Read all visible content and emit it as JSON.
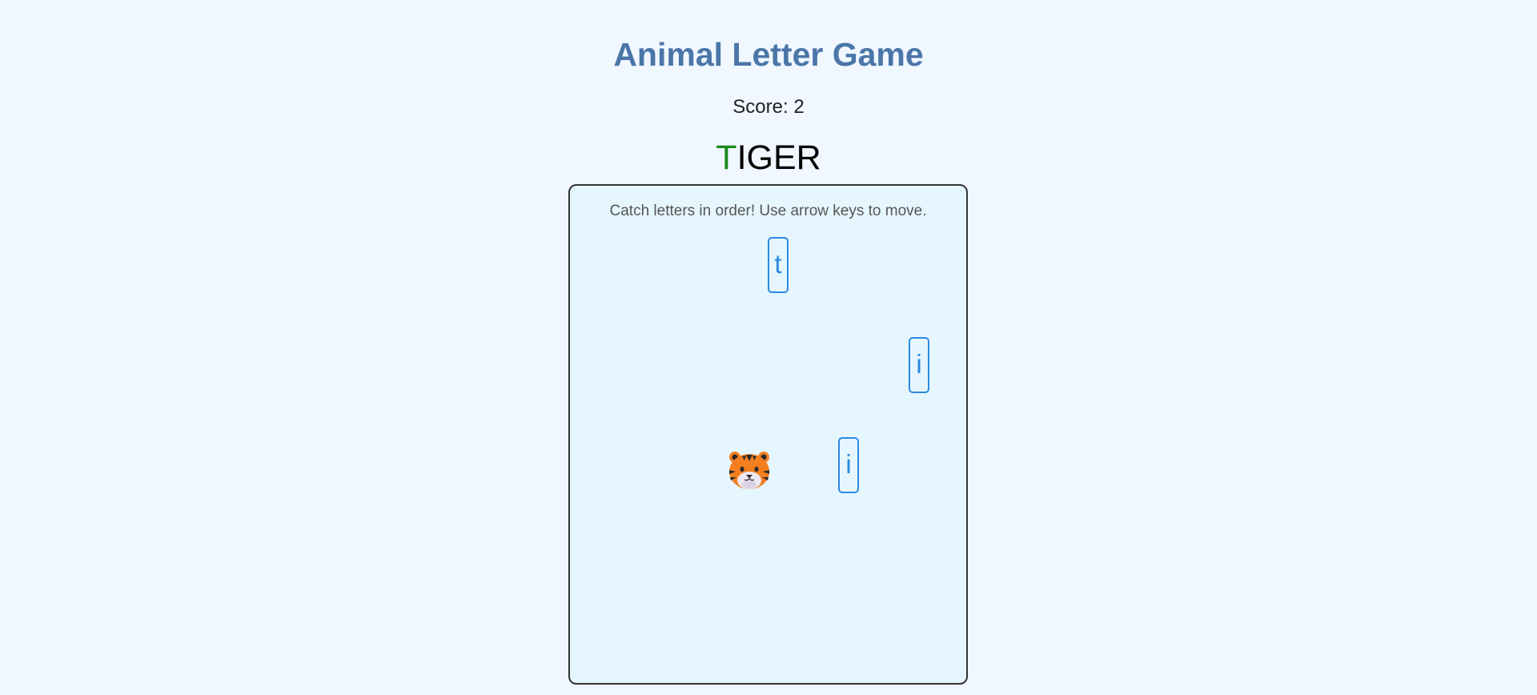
{
  "header": {
    "title": "Animal Letter Game",
    "score_text": "Score: 2"
  },
  "target_word": {
    "caught": "T",
    "pending": "IGER",
    "caught_color": "#1a8a1a",
    "pending_color": "#000000"
  },
  "game": {
    "instructions": "Catch letters in order! Use arrow keys to move.",
    "falling_letters": [
      "t",
      "i",
      "i"
    ],
    "player_icon": "tiger-face-icon"
  },
  "colors": {
    "background": "#f0f7ff",
    "title": "#4a76a8",
    "game_area_bg": "#e6f6fe",
    "letter_border": "#2a8ae0"
  }
}
